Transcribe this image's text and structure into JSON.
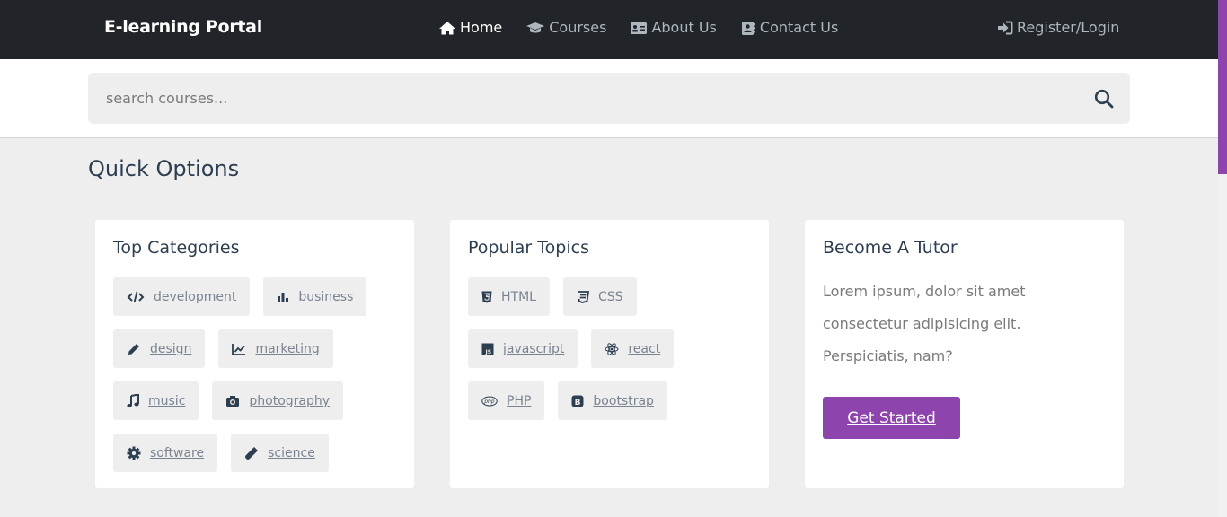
{
  "navbar": {
    "brand": "E-learning Portal",
    "links": [
      {
        "label": "Home",
        "icon": "home-icon",
        "active": true
      },
      {
        "label": "Courses",
        "icon": "graduation-cap-icon",
        "active": false
      },
      {
        "label": "About Us",
        "icon": "id-card-icon",
        "active": false
      },
      {
        "label": "Contact Us",
        "icon": "address-book-icon",
        "active": false
      }
    ],
    "register": {
      "label": "Register/Login",
      "icon": "sign-in-icon"
    }
  },
  "search": {
    "placeholder": "search courses...",
    "value": "",
    "icon": "search-icon"
  },
  "quick_options": {
    "title": "Quick Options",
    "top_categories": {
      "title": "Top Categories",
      "items": [
        {
          "label": "development",
          "icon": "code-icon"
        },
        {
          "label": "business",
          "icon": "chart-bar-icon"
        },
        {
          "label": "design",
          "icon": "pencil-icon"
        },
        {
          "label": "marketing",
          "icon": "chart-line-icon"
        },
        {
          "label": "music",
          "icon": "music-icon"
        },
        {
          "label": "photography",
          "icon": "camera-icon"
        },
        {
          "label": "software",
          "icon": "gear-icon"
        },
        {
          "label": "science",
          "icon": "flask-icon"
        }
      ]
    },
    "popular_topics": {
      "title": "Popular Topics",
      "items": [
        {
          "label": "HTML",
          "icon": "html5-icon"
        },
        {
          "label": "CSS",
          "icon": "css3-icon"
        },
        {
          "label": "javascript",
          "icon": "js-icon"
        },
        {
          "label": "react",
          "icon": "react-icon"
        },
        {
          "label": "PHP",
          "icon": "php-icon"
        },
        {
          "label": "bootstrap",
          "icon": "bootstrap-icon"
        }
      ]
    },
    "become_tutor": {
      "title": "Become A Tutor",
      "text": "Lorem ipsum, dolor sit amet consectetur adipisicing elit. Perspiciatis, nam?",
      "cta": "Get Started"
    }
  },
  "colors": {
    "navbar_bg": "#212529",
    "accent": "#8e44ad",
    "page_bg": "#eeeeee",
    "heading": "#2c3e50"
  }
}
